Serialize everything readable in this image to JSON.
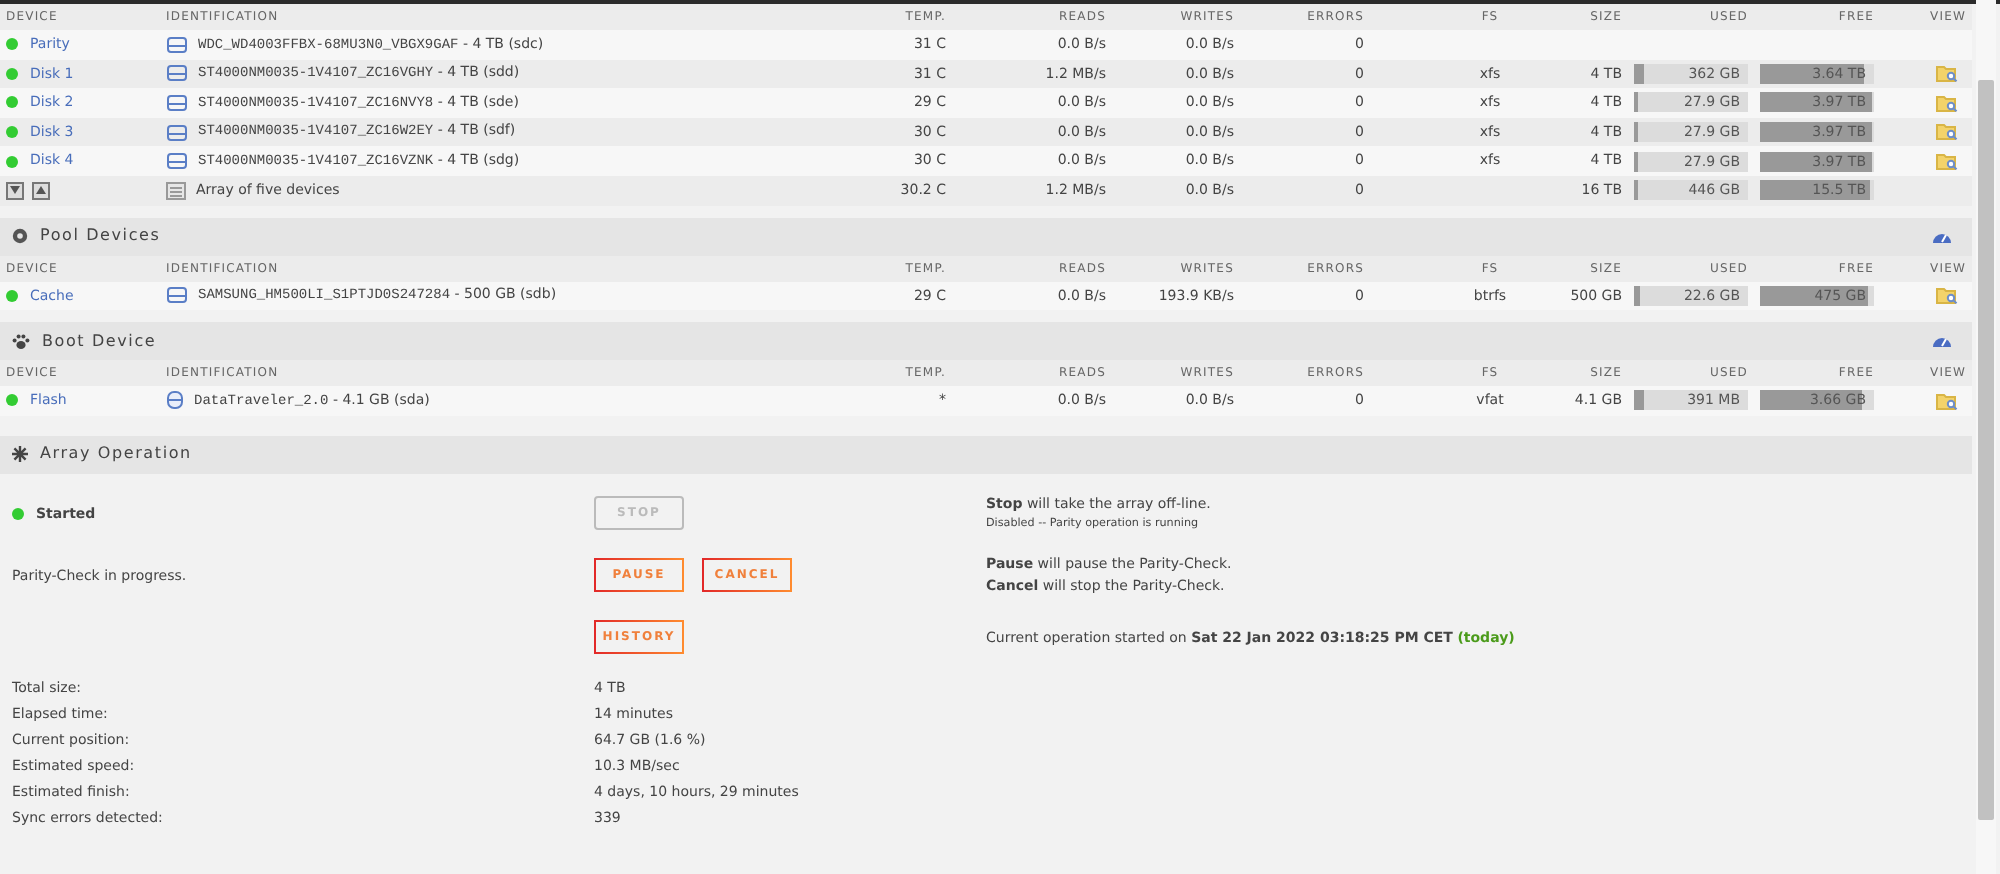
{
  "sections": [
    {
      "columns": [
        "DEVICE",
        "IDENTIFICATION",
        "TEMP.",
        "READS",
        "WRITES",
        "ERRORS",
        "FS",
        "SIZE",
        "USED",
        "FREE",
        "VIEW"
      ],
      "rows": [
        {
          "kind": "disk",
          "device": "Parity",
          "color": "#33cc33",
          "model": "WDC_WD4003FFBX-68MU3N0_VBGX9GAF",
          "capacity": "- 4 TB (sdc)",
          "temp": "31 C",
          "reads": "0.0 B/s",
          "writes": "0.0 B/s",
          "errors": "0"
        },
        {
          "kind": "disk",
          "device": "Disk 1",
          "color": "#33cc33",
          "model": "ST4000NM0035-1V4107_ZC16VGHY",
          "capacity": "- 4 TB (sdd)",
          "temp": "31 C",
          "reads": "1.2 MB/s",
          "writes": "0.0 B/s",
          "errors": "0",
          "fs": "xfs",
          "size": "4 TB",
          "used": {
            "text": "362 GB",
            "level": 0.09
          },
          "free": {
            "text": "3.64 TB",
            "level": 0.91
          },
          "view": true
        },
        {
          "kind": "disk",
          "device": "Disk 2",
          "color": "#33cc33",
          "model": "ST4000NM0035-1V4107_ZC16NVY8",
          "capacity": "- 4 TB (sde)",
          "temp": "29 C",
          "reads": "0.0 B/s",
          "writes": "0.0 B/s",
          "errors": "0",
          "fs": "xfs",
          "size": "4 TB",
          "used": {
            "text": "27.9 GB",
            "level": 0.01
          },
          "free": {
            "text": "3.97 TB",
            "level": 0.99
          },
          "view": true
        },
        {
          "kind": "disk",
          "device": "Disk 3",
          "color": "#33cc33",
          "model": "ST4000NM0035-1V4107_ZC16W2EY",
          "capacity": "- 4 TB (sdf)",
          "temp": "30 C",
          "reads": "0.0 B/s",
          "writes": "0.0 B/s",
          "errors": "0",
          "fs": "xfs",
          "size": "4 TB",
          "used": {
            "text": "27.9 GB",
            "level": 0.01
          },
          "free": {
            "text": "3.97 TB",
            "level": 0.99
          },
          "view": true
        },
        {
          "kind": "disk",
          "device": "Disk 4",
          "color": "#33cc33",
          "model": "ST4000NM0035-1V4107_ZC16VZNK",
          "capacity": "- 4 TB (sdg)",
          "temp": "30 C",
          "reads": "0.0 B/s",
          "writes": "0.0 B/s",
          "errors": "0",
          "fs": "xfs",
          "size": "4 TB",
          "used": {
            "text": "27.9 GB",
            "level": 0.01
          },
          "free": {
            "text": "3.97 TB",
            "level": 0.99
          },
          "view": true
        },
        {
          "kind": "summary",
          "model": "Array of five devices",
          "temp": "30.2 C",
          "reads": "1.2 MB/s",
          "writes": "0.0 B/s",
          "errors": "0",
          "size": "16 TB",
          "used": {
            "text": "446 GB",
            "level": 0.03
          },
          "free": {
            "text": "15.5 TB",
            "level": 0.97
          }
        }
      ]
    },
    {
      "kind": "pool",
      "title": "Pool Devices",
      "columns": [
        "DEVICE",
        "IDENTIFICATION",
        "TEMP.",
        "READS",
        "WRITES",
        "ERRORS",
        "FS",
        "SIZE",
        "USED",
        "FREE",
        "VIEW"
      ],
      "rows": [
        {
          "kind": "disk",
          "device": "Cache",
          "color": "#33cc33",
          "model": "SAMSUNG_HM500LI_S1PTJD0S247284",
          "capacity": "- 500 GB (sdb)",
          "temp": "29 C",
          "reads": "0.0 B/s",
          "writes": "193.9 KB/s",
          "errors": "0",
          "fs": "btrfs",
          "size": "500 GB",
          "used": {
            "text": "22.6 GB",
            "level": 0.045
          },
          "free": {
            "text": "475 GB",
            "level": 0.95
          },
          "view": true
        }
      ]
    },
    {
      "kind": "boot",
      "title": "Boot Device",
      "columns": [
        "DEVICE",
        "IDENTIFICATION",
        "TEMP.",
        "READS",
        "WRITES",
        "ERRORS",
        "FS",
        "SIZE",
        "USED",
        "FREE",
        "VIEW"
      ],
      "rows": [
        {
          "kind": "flash",
          "device": "Flash",
          "color": "#33cc33",
          "model": "DataTraveler_2.0",
          "capacity": "- 4.1 GB (sda)",
          "temp": "*",
          "reads": "0.0 B/s",
          "writes": "0.0 B/s",
          "errors": "0",
          "fs": "vfat",
          "size": "4.1 GB",
          "used": {
            "text": "391 MB",
            "level": 0.095
          },
          "free": {
            "text": "3.66 GB",
            "level": 0.89
          },
          "view": true
        }
      ]
    }
  ],
  "array_operation": {
    "title": "Array Operation",
    "rows": [
      {
        "label": "Started",
        "color": "#33cc33",
        "buttons": [
          {
            "label": "STOP",
            "disabled": true
          }
        ],
        "notes": [
          {
            "kind": "main",
            "text": "**Stop** will take the array off-line."
          },
          {
            "kind": "small",
            "text": "Disabled -- Parity operation is running"
          }
        ]
      },
      {
        "label": "Parity-Check in progress.",
        "buttons": [
          {
            "label": "PAUSE",
            "disabled": false
          },
          {
            "label": "CANCEL",
            "disabled": false
          }
        ],
        "notes": [
          {
            "kind": "main",
            "text": "**Pause** will pause the Parity-Check."
          },
          {
            "kind": "main",
            "text": "**Cancel** will stop the Parity-Check."
          }
        ]
      },
      {
        "buttons": [
          {
            "label": "HISTORY",
            "disabled": false
          }
        ],
        "notes": [
          {
            "kind": "main",
            "text": "Current operation started on **Sat 22 Jan 2022 03:18:25 PM CET** **(today)**"
          }
        ]
      }
    ],
    "details": [
      {
        "label": "Total size:",
        "value": "4 TB"
      },
      {
        "label": "Elapsed time:",
        "value": "14 minutes"
      },
      {
        "label": "Current position:",
        "value": "64.7 GB (1.6 %)"
      },
      {
        "label": "Estimated speed:",
        "value": "10.3 MB/sec"
      },
      {
        "label": "Estimated finish:",
        "value": "4 days, 10 hours, 29 minutes"
      },
      {
        "label": "Sync errors detected:",
        "value": "339"
      }
    ]
  }
}
